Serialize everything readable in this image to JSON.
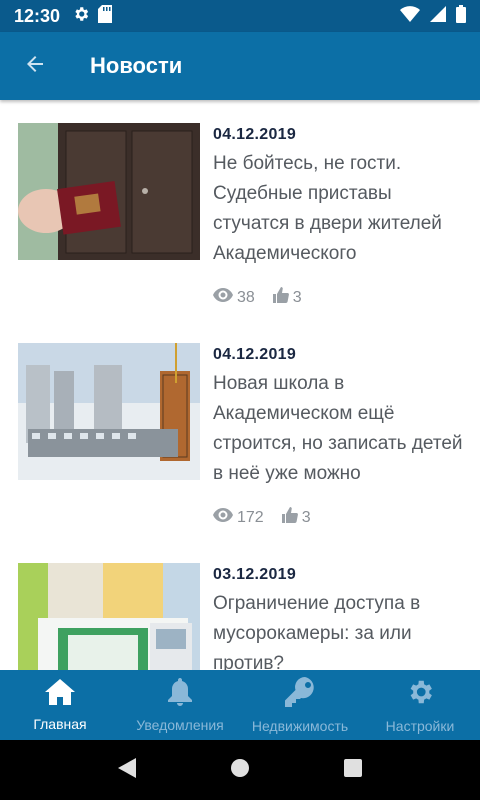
{
  "status_bar": {
    "time": "12:30",
    "icons": [
      "gear-icon",
      "sd-card-icon",
      "wifi-icon",
      "signal-icon",
      "battery-icon"
    ]
  },
  "app_bar": {
    "title": "Новости",
    "back_icon": "arrow-left-icon"
  },
  "news": [
    {
      "date": "04.12.2019",
      "title": "Не бойтесь, не гости. Судебные приставы стучатся в двери жителей Академического",
      "views": "38",
      "likes": "3"
    },
    {
      "date": "04.12.2019",
      "title": "Новая школа в Академическом ещё строится, но записать детей в неё уже можно",
      "views": "172",
      "likes": "3"
    },
    {
      "date": "03.12.2019",
      "title": "Ограничение доступа в мусорокамеры: за или против?",
      "views": "",
      "likes": ""
    }
  ],
  "bottom_nav": {
    "tabs": [
      {
        "label": "Главная",
        "icon": "home-icon",
        "active": true
      },
      {
        "label": "Уведомления",
        "icon": "bell-icon",
        "active": false
      },
      {
        "label": "Недвижимость",
        "icon": "key-icon",
        "active": false
      },
      {
        "label": "Настройки",
        "icon": "gear-icon",
        "active": false
      }
    ]
  },
  "system_nav": {
    "icons": [
      "back-triangle-icon",
      "home-circle-icon",
      "recents-square-icon"
    ]
  },
  "colors": {
    "status_bar": "#0a5a8c",
    "app_bar": "#0c6fa6",
    "date_text": "#1a2741",
    "title_text": "#555a60",
    "stats_text": "#8a8f95",
    "nav_inactive": "#8ab8d8"
  }
}
